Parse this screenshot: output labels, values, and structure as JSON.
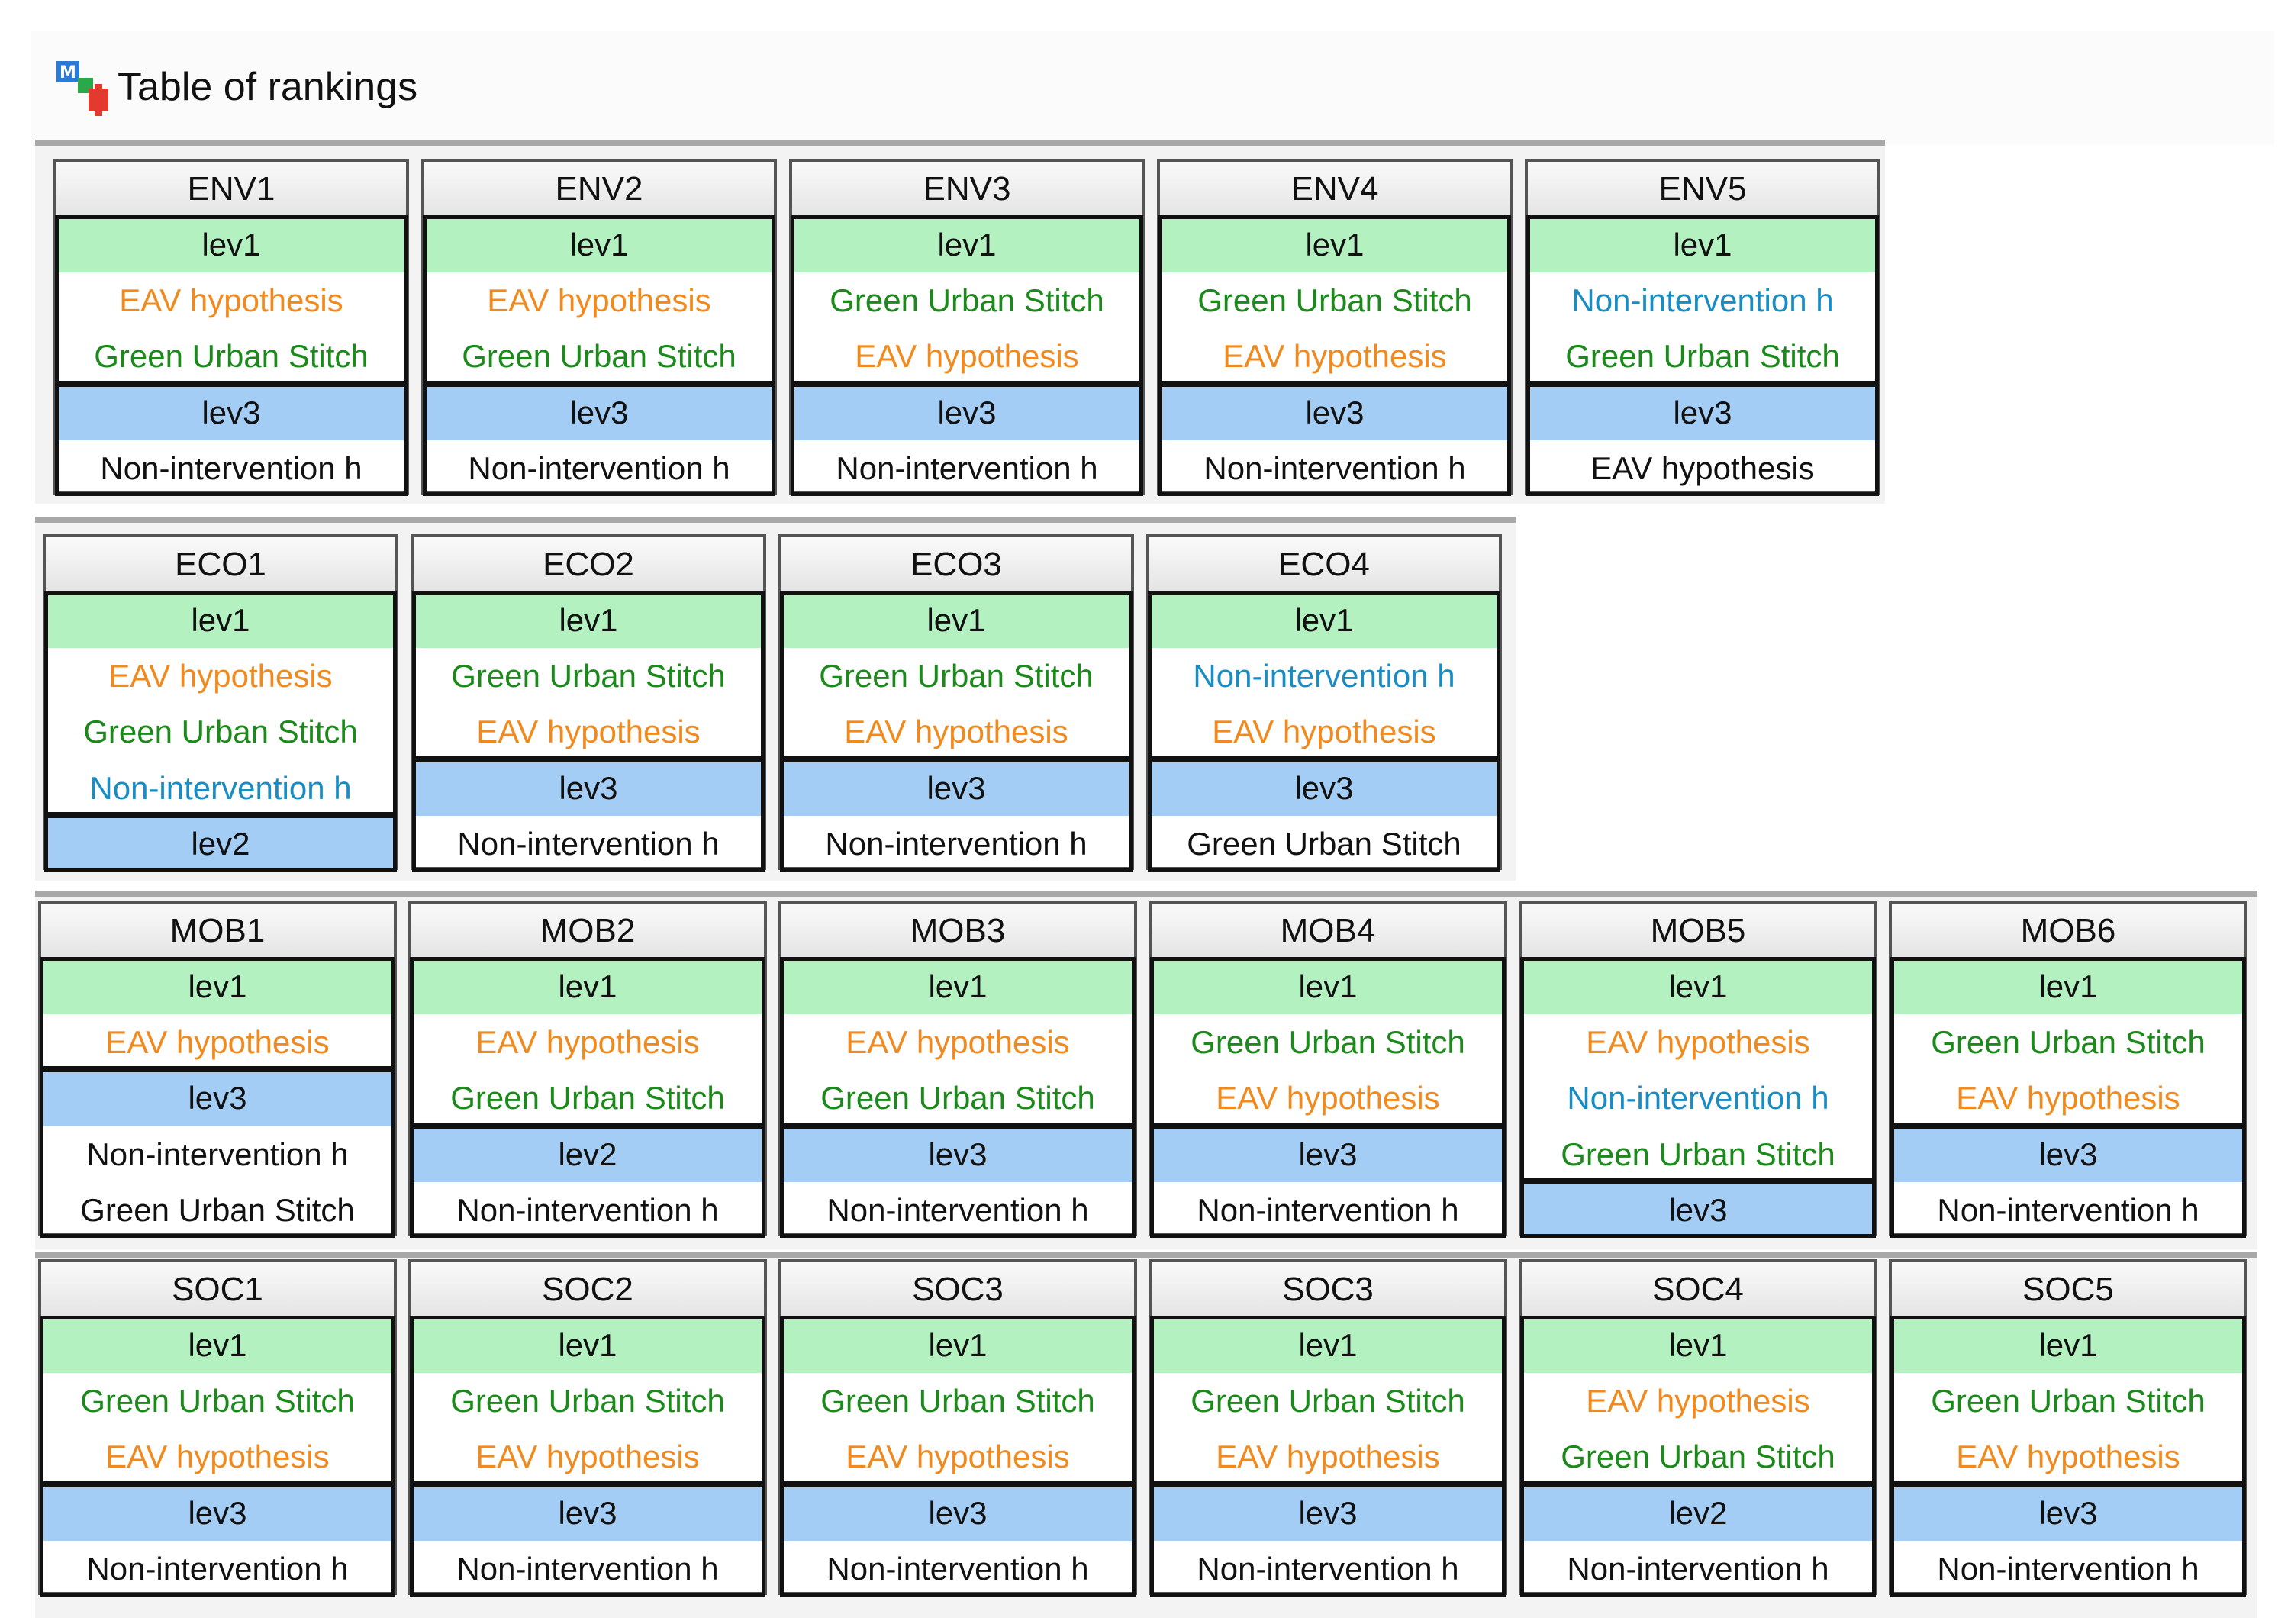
{
  "window": {
    "title": "Table of rankings",
    "icon": "app-logo-icon"
  },
  "colors": {
    "level_green": "#b3f2c0",
    "level_blue": "#a3cdf4",
    "option_orange": "#f08a1e",
    "option_green": "#1b8a1b",
    "option_cyan": "#1a8cc4",
    "text_dark": "#111111"
  },
  "rows": [
    {
      "panels": [
        {
          "name": "ENV1",
          "cells": [
            {
              "text": "lev1",
              "kind": "level",
              "fill": "green"
            },
            {
              "text": "EAV hypothesis",
              "kind": "option",
              "color": "orange"
            },
            {
              "text": "Green Urban Stitch",
              "kind": "option",
              "color": "green"
            },
            {
              "text": "lev3",
              "kind": "level",
              "fill": "blue"
            },
            {
              "text": "Non-intervention h",
              "kind": "option",
              "color": "dark"
            }
          ]
        },
        {
          "name": "ENV2",
          "cells": [
            {
              "text": "lev1",
              "kind": "level",
              "fill": "green"
            },
            {
              "text": "EAV hypothesis",
              "kind": "option",
              "color": "orange"
            },
            {
              "text": "Green Urban Stitch",
              "kind": "option",
              "color": "green"
            },
            {
              "text": "lev3",
              "kind": "level",
              "fill": "blue"
            },
            {
              "text": "Non-intervention h",
              "kind": "option",
              "color": "dark"
            }
          ]
        },
        {
          "name": "ENV3",
          "cells": [
            {
              "text": "lev1",
              "kind": "level",
              "fill": "green"
            },
            {
              "text": "Green Urban Stitch",
              "kind": "option",
              "color": "green"
            },
            {
              "text": "EAV hypothesis",
              "kind": "option",
              "color": "orange"
            },
            {
              "text": "lev3",
              "kind": "level",
              "fill": "blue"
            },
            {
              "text": "Non-intervention h",
              "kind": "option",
              "color": "dark"
            }
          ]
        },
        {
          "name": "ENV4",
          "cells": [
            {
              "text": "lev1",
              "kind": "level",
              "fill": "green"
            },
            {
              "text": "Green Urban Stitch",
              "kind": "option",
              "color": "green"
            },
            {
              "text": "EAV hypothesis",
              "kind": "option",
              "color": "orange"
            },
            {
              "text": "lev3",
              "kind": "level",
              "fill": "blue"
            },
            {
              "text": "Non-intervention h",
              "kind": "option",
              "color": "dark"
            }
          ]
        },
        {
          "name": "ENV5",
          "cells": [
            {
              "text": "lev1",
              "kind": "level",
              "fill": "green"
            },
            {
              "text": "Non-intervention h",
              "kind": "option",
              "color": "cyan"
            },
            {
              "text": "Green Urban Stitch",
              "kind": "option",
              "color": "green"
            },
            {
              "text": "lev3",
              "kind": "level",
              "fill": "blue"
            },
            {
              "text": "EAV hypothesis",
              "kind": "option",
              "color": "dark"
            }
          ]
        }
      ]
    },
    {
      "panels": [
        {
          "name": "ECO1",
          "cells": [
            {
              "text": "lev1",
              "kind": "level",
              "fill": "green"
            },
            {
              "text": "EAV hypothesis",
              "kind": "option",
              "color": "orange"
            },
            {
              "text": "Green Urban Stitch",
              "kind": "option",
              "color": "green"
            },
            {
              "text": "Non-intervention h",
              "kind": "option",
              "color": "cyan"
            },
            {
              "text": "lev2",
              "kind": "level",
              "fill": "blue"
            }
          ]
        },
        {
          "name": "ECO2",
          "cells": [
            {
              "text": "lev1",
              "kind": "level",
              "fill": "green"
            },
            {
              "text": "Green Urban Stitch",
              "kind": "option",
              "color": "green"
            },
            {
              "text": "EAV hypothesis",
              "kind": "option",
              "color": "orange"
            },
            {
              "text": "lev3",
              "kind": "level",
              "fill": "blue"
            },
            {
              "text": "Non-intervention h",
              "kind": "option",
              "color": "dark"
            }
          ]
        },
        {
          "name": "ECO3",
          "cells": [
            {
              "text": "lev1",
              "kind": "level",
              "fill": "green"
            },
            {
              "text": "Green Urban Stitch",
              "kind": "option",
              "color": "green"
            },
            {
              "text": "EAV hypothesis",
              "kind": "option",
              "color": "orange"
            },
            {
              "text": "lev3",
              "kind": "level",
              "fill": "blue"
            },
            {
              "text": "Non-intervention h",
              "kind": "option",
              "color": "dark"
            }
          ]
        },
        {
          "name": "ECO4",
          "cells": [
            {
              "text": "lev1",
              "kind": "level",
              "fill": "green"
            },
            {
              "text": "Non-intervention h",
              "kind": "option",
              "color": "cyan"
            },
            {
              "text": "EAV hypothesis",
              "kind": "option",
              "color": "orange"
            },
            {
              "text": "lev3",
              "kind": "level",
              "fill": "blue"
            },
            {
              "text": "Green Urban Stitch",
              "kind": "option",
              "color": "dark"
            }
          ]
        }
      ]
    },
    {
      "panels": [
        {
          "name": "MOB1",
          "cells": [
            {
              "text": "lev1",
              "kind": "level",
              "fill": "green"
            },
            {
              "text": "EAV hypothesis",
              "kind": "option",
              "color": "orange"
            },
            {
              "text": "lev3",
              "kind": "level",
              "fill": "blue"
            },
            {
              "text": "Non-intervention h",
              "kind": "option",
              "color": "dark"
            },
            {
              "text": "Green Urban Stitch",
              "kind": "option",
              "color": "dark"
            }
          ]
        },
        {
          "name": "MOB2",
          "cells": [
            {
              "text": "lev1",
              "kind": "level",
              "fill": "green"
            },
            {
              "text": "EAV hypothesis",
              "kind": "option",
              "color": "orange"
            },
            {
              "text": "Green Urban Stitch",
              "kind": "option",
              "color": "green"
            },
            {
              "text": "lev2",
              "kind": "level",
              "fill": "blue"
            },
            {
              "text": "Non-intervention h",
              "kind": "option",
              "color": "dark"
            }
          ]
        },
        {
          "name": "MOB3",
          "cells": [
            {
              "text": "lev1",
              "kind": "level",
              "fill": "green"
            },
            {
              "text": "EAV hypothesis",
              "kind": "option",
              "color": "orange"
            },
            {
              "text": "Green Urban Stitch",
              "kind": "option",
              "color": "green"
            },
            {
              "text": "lev3",
              "kind": "level",
              "fill": "blue"
            },
            {
              "text": "Non-intervention h",
              "kind": "option",
              "color": "dark"
            }
          ]
        },
        {
          "name": "MOB4",
          "cells": [
            {
              "text": "lev1",
              "kind": "level",
              "fill": "green"
            },
            {
              "text": "Green Urban Stitch",
              "kind": "option",
              "color": "green"
            },
            {
              "text": "EAV hypothesis",
              "kind": "option",
              "color": "orange"
            },
            {
              "text": "lev3",
              "kind": "level",
              "fill": "blue"
            },
            {
              "text": "Non-intervention h",
              "kind": "option",
              "color": "dark"
            }
          ]
        },
        {
          "name": "MOB5",
          "cells": [
            {
              "text": "lev1",
              "kind": "level",
              "fill": "green"
            },
            {
              "text": "EAV hypothesis",
              "kind": "option",
              "color": "orange"
            },
            {
              "text": "Non-intervention h",
              "kind": "option",
              "color": "cyan"
            },
            {
              "text": "Green Urban Stitch",
              "kind": "option",
              "color": "green"
            },
            {
              "text": "lev3",
              "kind": "level",
              "fill": "blue"
            }
          ]
        },
        {
          "name": "MOB6",
          "cells": [
            {
              "text": "lev1",
              "kind": "level",
              "fill": "green"
            },
            {
              "text": "Green Urban Stitch",
              "kind": "option",
              "color": "green"
            },
            {
              "text": "EAV hypothesis",
              "kind": "option",
              "color": "orange"
            },
            {
              "text": "lev3",
              "kind": "level",
              "fill": "blue"
            },
            {
              "text": "Non-intervention h",
              "kind": "option",
              "color": "dark"
            }
          ]
        }
      ]
    },
    {
      "panels": [
        {
          "name": "SOC1",
          "cells": [
            {
              "text": "lev1",
              "kind": "level",
              "fill": "green"
            },
            {
              "text": "Green Urban Stitch",
              "kind": "option",
              "color": "green"
            },
            {
              "text": "EAV hypothesis",
              "kind": "option",
              "color": "orange"
            },
            {
              "text": "lev3",
              "kind": "level",
              "fill": "blue"
            },
            {
              "text": "Non-intervention h",
              "kind": "option",
              "color": "dark"
            }
          ]
        },
        {
          "name": "SOC2",
          "cells": [
            {
              "text": "lev1",
              "kind": "level",
              "fill": "green"
            },
            {
              "text": "Green Urban Stitch",
              "kind": "option",
              "color": "green"
            },
            {
              "text": "EAV hypothesis",
              "kind": "option",
              "color": "orange"
            },
            {
              "text": "lev3",
              "kind": "level",
              "fill": "blue"
            },
            {
              "text": "Non-intervention h",
              "kind": "option",
              "color": "dark"
            }
          ]
        },
        {
          "name": "SOC3",
          "cells": [
            {
              "text": "lev1",
              "kind": "level",
              "fill": "green"
            },
            {
              "text": "Green Urban Stitch",
              "kind": "option",
              "color": "green"
            },
            {
              "text": "EAV hypothesis",
              "kind": "option",
              "color": "orange"
            },
            {
              "text": "lev3",
              "kind": "level",
              "fill": "blue"
            },
            {
              "text": "Non-intervention h",
              "kind": "option",
              "color": "dark"
            }
          ]
        },
        {
          "name": "SOC3",
          "cells": [
            {
              "text": "lev1",
              "kind": "level",
              "fill": "green"
            },
            {
              "text": "Green Urban Stitch",
              "kind": "option",
              "color": "green"
            },
            {
              "text": "EAV hypothesis",
              "kind": "option",
              "color": "orange"
            },
            {
              "text": "lev3",
              "kind": "level",
              "fill": "blue"
            },
            {
              "text": "Non-intervention h",
              "kind": "option",
              "color": "dark"
            }
          ]
        },
        {
          "name": "SOC4",
          "cells": [
            {
              "text": "lev1",
              "kind": "level",
              "fill": "green"
            },
            {
              "text": "EAV hypothesis",
              "kind": "option",
              "color": "orange"
            },
            {
              "text": "Green Urban Stitch",
              "kind": "option",
              "color": "green"
            },
            {
              "text": "lev2",
              "kind": "level",
              "fill": "blue"
            },
            {
              "text": "Non-intervention h",
              "kind": "option",
              "color": "dark"
            }
          ]
        },
        {
          "name": "SOC5",
          "cells": [
            {
              "text": "lev1",
              "kind": "level",
              "fill": "green"
            },
            {
              "text": "Green Urban Stitch",
              "kind": "option",
              "color": "green"
            },
            {
              "text": "EAV hypothesis",
              "kind": "option",
              "color": "orange"
            },
            {
              "text": "lev3",
              "kind": "level",
              "fill": "blue"
            },
            {
              "text": "Non-intervention h",
              "kind": "option",
              "color": "dark"
            }
          ]
        }
      ]
    }
  ]
}
